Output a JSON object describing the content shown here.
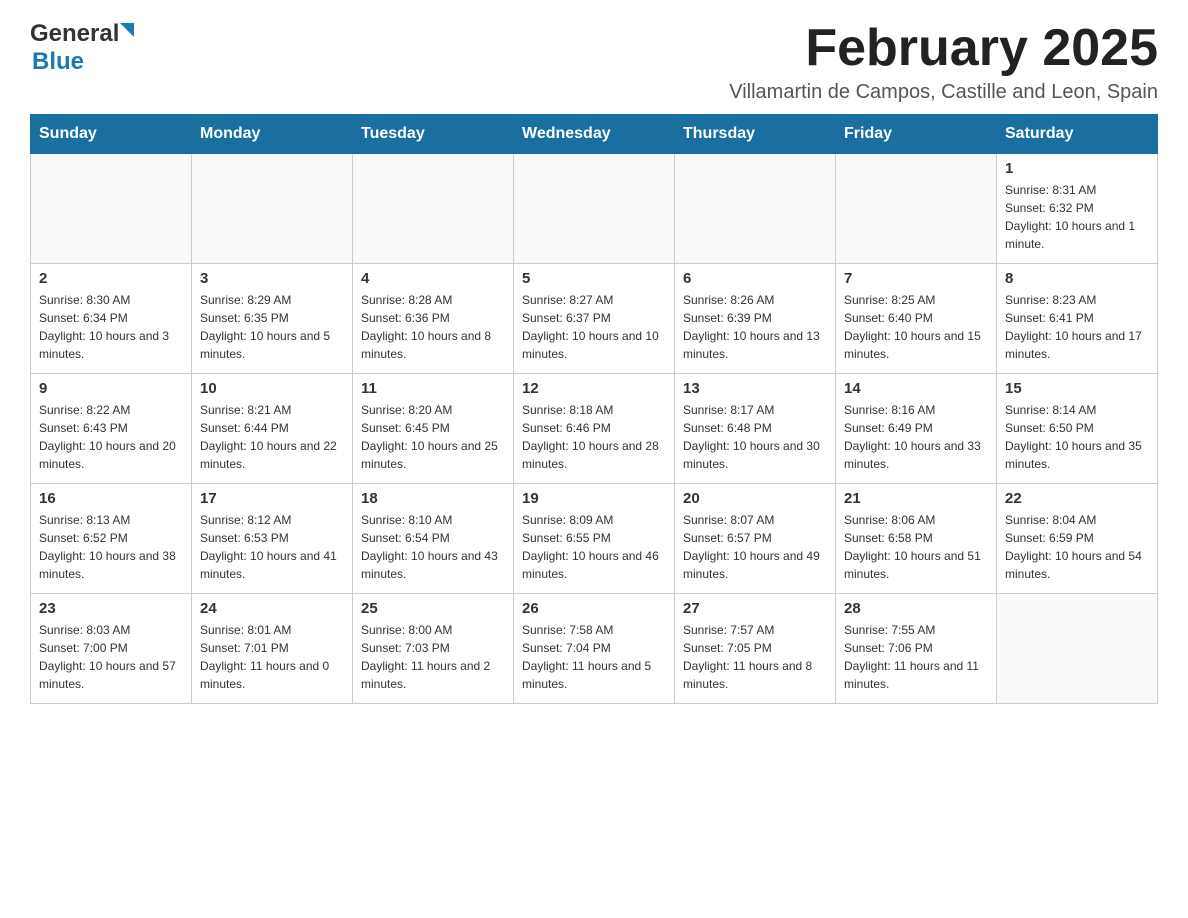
{
  "header": {
    "logo_general": "General",
    "logo_blue": "Blue",
    "month_title": "February 2025",
    "location": "Villamartin de Campos, Castille and Leon, Spain"
  },
  "days_of_week": [
    "Sunday",
    "Monday",
    "Tuesday",
    "Wednesday",
    "Thursday",
    "Friday",
    "Saturday"
  ],
  "weeks": [
    {
      "days": [
        {
          "number": "",
          "info": ""
        },
        {
          "number": "",
          "info": ""
        },
        {
          "number": "",
          "info": ""
        },
        {
          "number": "",
          "info": ""
        },
        {
          "number": "",
          "info": ""
        },
        {
          "number": "",
          "info": ""
        },
        {
          "number": "1",
          "info": "Sunrise: 8:31 AM\nSunset: 6:32 PM\nDaylight: 10 hours and 1 minute."
        }
      ]
    },
    {
      "days": [
        {
          "number": "2",
          "info": "Sunrise: 8:30 AM\nSunset: 6:34 PM\nDaylight: 10 hours and 3 minutes."
        },
        {
          "number": "3",
          "info": "Sunrise: 8:29 AM\nSunset: 6:35 PM\nDaylight: 10 hours and 5 minutes."
        },
        {
          "number": "4",
          "info": "Sunrise: 8:28 AM\nSunset: 6:36 PM\nDaylight: 10 hours and 8 minutes."
        },
        {
          "number": "5",
          "info": "Sunrise: 8:27 AM\nSunset: 6:37 PM\nDaylight: 10 hours and 10 minutes."
        },
        {
          "number": "6",
          "info": "Sunrise: 8:26 AM\nSunset: 6:39 PM\nDaylight: 10 hours and 13 minutes."
        },
        {
          "number": "7",
          "info": "Sunrise: 8:25 AM\nSunset: 6:40 PM\nDaylight: 10 hours and 15 minutes."
        },
        {
          "number": "8",
          "info": "Sunrise: 8:23 AM\nSunset: 6:41 PM\nDaylight: 10 hours and 17 minutes."
        }
      ]
    },
    {
      "days": [
        {
          "number": "9",
          "info": "Sunrise: 8:22 AM\nSunset: 6:43 PM\nDaylight: 10 hours and 20 minutes."
        },
        {
          "number": "10",
          "info": "Sunrise: 8:21 AM\nSunset: 6:44 PM\nDaylight: 10 hours and 22 minutes."
        },
        {
          "number": "11",
          "info": "Sunrise: 8:20 AM\nSunset: 6:45 PM\nDaylight: 10 hours and 25 minutes."
        },
        {
          "number": "12",
          "info": "Sunrise: 8:18 AM\nSunset: 6:46 PM\nDaylight: 10 hours and 28 minutes."
        },
        {
          "number": "13",
          "info": "Sunrise: 8:17 AM\nSunset: 6:48 PM\nDaylight: 10 hours and 30 minutes."
        },
        {
          "number": "14",
          "info": "Sunrise: 8:16 AM\nSunset: 6:49 PM\nDaylight: 10 hours and 33 minutes."
        },
        {
          "number": "15",
          "info": "Sunrise: 8:14 AM\nSunset: 6:50 PM\nDaylight: 10 hours and 35 minutes."
        }
      ]
    },
    {
      "days": [
        {
          "number": "16",
          "info": "Sunrise: 8:13 AM\nSunset: 6:52 PM\nDaylight: 10 hours and 38 minutes."
        },
        {
          "number": "17",
          "info": "Sunrise: 8:12 AM\nSunset: 6:53 PM\nDaylight: 10 hours and 41 minutes."
        },
        {
          "number": "18",
          "info": "Sunrise: 8:10 AM\nSunset: 6:54 PM\nDaylight: 10 hours and 43 minutes."
        },
        {
          "number": "19",
          "info": "Sunrise: 8:09 AM\nSunset: 6:55 PM\nDaylight: 10 hours and 46 minutes."
        },
        {
          "number": "20",
          "info": "Sunrise: 8:07 AM\nSunset: 6:57 PM\nDaylight: 10 hours and 49 minutes."
        },
        {
          "number": "21",
          "info": "Sunrise: 8:06 AM\nSunset: 6:58 PM\nDaylight: 10 hours and 51 minutes."
        },
        {
          "number": "22",
          "info": "Sunrise: 8:04 AM\nSunset: 6:59 PM\nDaylight: 10 hours and 54 minutes."
        }
      ]
    },
    {
      "days": [
        {
          "number": "23",
          "info": "Sunrise: 8:03 AM\nSunset: 7:00 PM\nDaylight: 10 hours and 57 minutes."
        },
        {
          "number": "24",
          "info": "Sunrise: 8:01 AM\nSunset: 7:01 PM\nDaylight: 11 hours and 0 minutes."
        },
        {
          "number": "25",
          "info": "Sunrise: 8:00 AM\nSunset: 7:03 PM\nDaylight: 11 hours and 2 minutes."
        },
        {
          "number": "26",
          "info": "Sunrise: 7:58 AM\nSunset: 7:04 PM\nDaylight: 11 hours and 5 minutes."
        },
        {
          "number": "27",
          "info": "Sunrise: 7:57 AM\nSunset: 7:05 PM\nDaylight: 11 hours and 8 minutes."
        },
        {
          "number": "28",
          "info": "Sunrise: 7:55 AM\nSunset: 7:06 PM\nDaylight: 11 hours and 11 minutes."
        },
        {
          "number": "",
          "info": ""
        }
      ]
    }
  ]
}
